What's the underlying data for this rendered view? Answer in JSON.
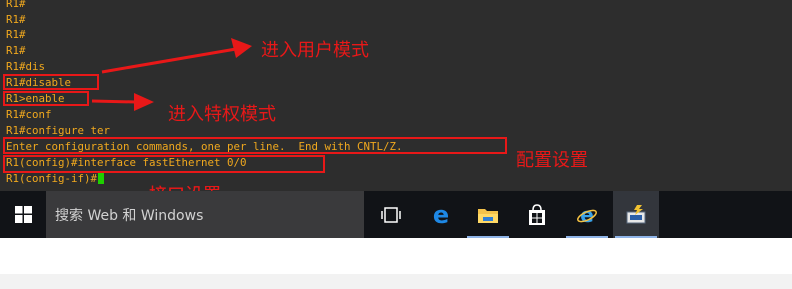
{
  "terminal": {
    "lines": [
      "R1#",
      "R1#",
      "R1#",
      "R1#",
      "R1#dis",
      "R1#disable",
      "R1>enable",
      "R1#conf",
      "R1#configure ter",
      "Enter configuration commands, one per line.  End with CNTL/Z.",
      "R1(config)#interface fastEthernet 0/0",
      "R1(config-if)#"
    ]
  },
  "annotations": {
    "user_mode": "进入用户模式",
    "privileged_mode": "进入特权模式",
    "config": "配置设置",
    "interface": "接口设置"
  },
  "taskbar": {
    "search_placeholder": "搜索 Web 和 Windows",
    "icons": [
      "windows-start-icon",
      "task-view-icon",
      "edge-icon",
      "file-explorer-icon",
      "store-icon",
      "ie-icon",
      "network-app-icon"
    ]
  },
  "colors": {
    "terminal_bg": "#2d2d2d",
    "terminal_text": "#f0a81e",
    "cursor": "#1fd000",
    "annotation_red": "#e81818",
    "taskbar_bg": "#111317",
    "search_bg": "#3a3a3c"
  }
}
